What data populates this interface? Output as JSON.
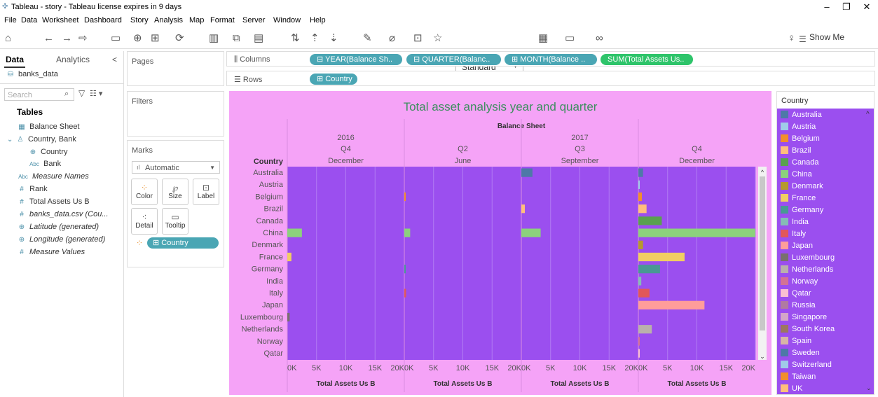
{
  "window": {
    "title": "Tableau - story - Tableau license expires in 9 days",
    "minimize": "–",
    "restore": "❐",
    "close": "✕"
  },
  "menu": [
    "File",
    "Data",
    "Worksheet",
    "Dashboard",
    "Story",
    "Analysis",
    "Map",
    "Format",
    "Server",
    "Window",
    "Help"
  ],
  "toolbar": {
    "fit_select": "Standard",
    "show_me": "Show Me"
  },
  "left_pane": {
    "tab_data": "Data",
    "tab_analytics": "Analytics",
    "collapse": "<",
    "datasource": "banks_data",
    "search_placeholder": "Search",
    "tables_label": "Tables",
    "fields": [
      {
        "label": "Balance Sheet",
        "icon": "calendar-icon",
        "italic": false
      },
      {
        "label": "Country, Bank",
        "icon": "hierarchy-icon",
        "italic": false
      },
      {
        "label": "Country",
        "icon": "globe-icon",
        "italic": false
      },
      {
        "label": "Bank",
        "icon": "abc-icon",
        "italic": false
      },
      {
        "label": "Measure Names",
        "icon": "abc-icon",
        "italic": true
      },
      {
        "label": "Rank",
        "icon": "measure-icon",
        "italic": false
      },
      {
        "label": "Total Assets Us B",
        "icon": "measure-icon",
        "italic": false
      },
      {
        "label": "banks_data.csv (Cou...",
        "icon": "measure-icon",
        "italic": true
      },
      {
        "label": "Latitude (generated)",
        "icon": "globe-icon",
        "italic": true
      },
      {
        "label": "Longitude (generated)",
        "icon": "globe-icon",
        "italic": true
      },
      {
        "label": "Measure Values",
        "icon": "measure-icon",
        "italic": true
      }
    ]
  },
  "cards": {
    "pages": "Pages",
    "filters": "Filters",
    "marks": "Marks",
    "mark_type": "Automatic",
    "mark_buttons": [
      "Color",
      "Size",
      "Label",
      "Detail",
      "Tooltip"
    ],
    "country_pill": "Country"
  },
  "shelves": {
    "columns_label": "Columns",
    "rows_label": "Rows",
    "columns": [
      "YEAR(Balance Sh..",
      "QUARTER(Balanc..",
      "MONTH(Balance ..",
      "SUM(Total Assets Us.."
    ],
    "rows": [
      "Country"
    ]
  },
  "colors": {
    "viz_bg": "#f5a3f7",
    "pane_bg": "#9b4fef",
    "title": "#3c8f5e",
    "pill_blue": "#4aa6b4",
    "pill_green": "#2ec46a"
  },
  "legend": {
    "title": "Country",
    "items": [
      {
        "name": "Australia",
        "color": "#4e79a7"
      },
      {
        "name": "Austria",
        "color": "#a0cbe8"
      },
      {
        "name": "Belgium",
        "color": "#f28e2b"
      },
      {
        "name": "Brazil",
        "color": "#ffbe7d"
      },
      {
        "name": "Canada",
        "color": "#59a14f"
      },
      {
        "name": "China",
        "color": "#8cd17d"
      },
      {
        "name": "Denmark",
        "color": "#b6992d"
      },
      {
        "name": "France",
        "color": "#f1ce63"
      },
      {
        "name": "Germany",
        "color": "#499894"
      },
      {
        "name": "India",
        "color": "#86bcb6"
      },
      {
        "name": "Italy",
        "color": "#e15759"
      },
      {
        "name": "Japan",
        "color": "#ff9d9a"
      },
      {
        "name": "Luxembourg",
        "color": "#79706e"
      },
      {
        "name": "Netherlands",
        "color": "#bab0ac"
      },
      {
        "name": "Norway",
        "color": "#d37295"
      },
      {
        "name": "Qatar",
        "color": "#fabfd2"
      },
      {
        "name": "Russia",
        "color": "#b07aa1"
      },
      {
        "name": "Singapore",
        "color": "#d4a6c8"
      },
      {
        "name": "South Korea",
        "color": "#9d7660"
      },
      {
        "name": "Spain",
        "color": "#d7b5a6"
      },
      {
        "name": "Sweden",
        "color": "#4e79a7"
      },
      {
        "name": "Switzerland",
        "color": "#a0cbe8"
      },
      {
        "name": "Taiwan",
        "color": "#f28e2b"
      },
      {
        "name": "UK",
        "color": "#ffbe7d"
      }
    ]
  },
  "chart_data": {
    "type": "bar",
    "title": "Total asset analysis year and quarter",
    "column_header": "Balance Sheet",
    "row_header": "Country",
    "xlabel": "Total Assets Us B",
    "xlim": [
      0,
      20000
    ],
    "x_ticks": [
      "0K",
      "5K",
      "10K",
      "15K",
      "20K"
    ],
    "panels": [
      {
        "year": "2016",
        "quarter": "Q4",
        "month": "December"
      },
      {
        "year": "2017",
        "quarter": "Q2",
        "month": "June"
      },
      {
        "year": "",
        "quarter": "Q3",
        "month": "September"
      },
      {
        "year": "",
        "quarter": "Q4",
        "month": "December"
      }
    ],
    "categories": [
      "Australia",
      "Austria",
      "Belgium",
      "Brazil",
      "Canada",
      "China",
      "Denmark",
      "France",
      "Germany",
      "India",
      "Italy",
      "Japan",
      "Luxembourg",
      "Netherlands",
      "Norway",
      "Qatar"
    ],
    "series": [
      {
        "name": "2016 Q4 December",
        "values": [
          0,
          0,
          0,
          0,
          0,
          2500,
          0,
          700,
          0,
          0,
          0,
          0,
          400,
          0,
          0,
          0
        ]
      },
      {
        "name": "2017 Q2 June",
        "values": [
          0,
          0,
          100,
          0,
          0,
          1000,
          0,
          0,
          150,
          0,
          300,
          0,
          0,
          0,
          0,
          0
        ]
      },
      {
        "name": "2017 Q3 September",
        "values": [
          1900,
          0,
          0,
          600,
          0,
          3300,
          0,
          0,
          0,
          0,
          0,
          0,
          0,
          0,
          0,
          0
        ]
      },
      {
        "name": "2017 Q4 December",
        "values": [
          800,
          100,
          600,
          1400,
          4000,
          20000,
          800,
          7900,
          3700,
          500,
          1900,
          11300,
          0,
          2300,
          100,
          100
        ]
      }
    ]
  }
}
